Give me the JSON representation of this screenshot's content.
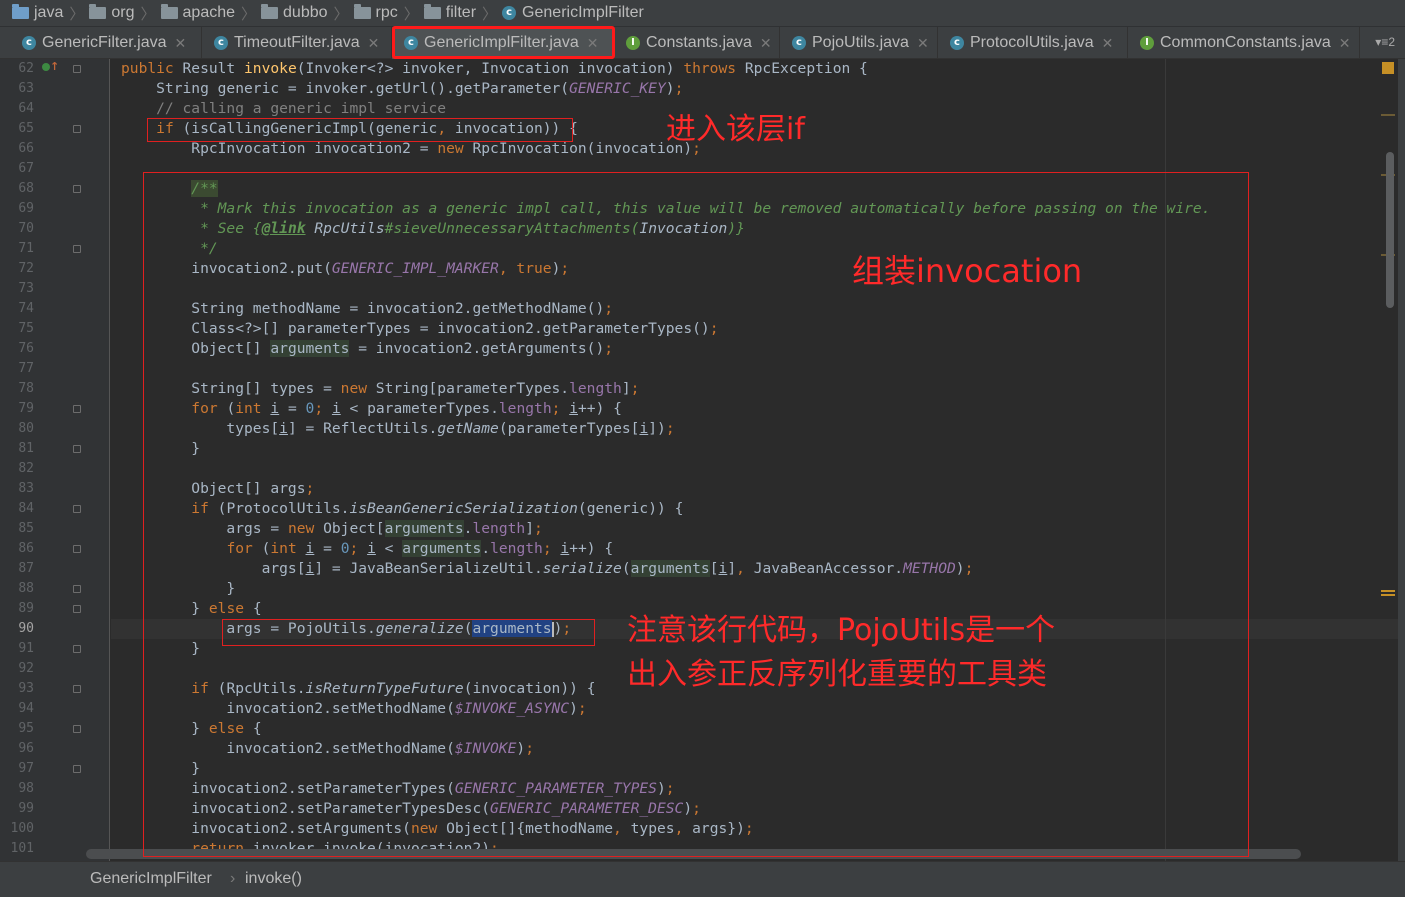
{
  "breadcrumb": [
    "java",
    "org",
    "apache",
    "dubbo",
    "rpc",
    "filter",
    "GenericImplFilter"
  ],
  "tabs": [
    {
      "label": "GenericFilter.java",
      "type": "class",
      "active": false
    },
    {
      "label": "TimeoutFilter.java",
      "type": "class",
      "active": false
    },
    {
      "label": "GenericImplFilter.java",
      "type": "class",
      "active": true
    },
    {
      "label": "Constants.java",
      "type": "interface",
      "active": false
    },
    {
      "label": "PojoUtils.java",
      "type": "class",
      "active": false
    },
    {
      "label": "ProtocolUtils.java",
      "type": "class",
      "active": false
    },
    {
      "label": "CommonConstants.java",
      "type": "interface",
      "active": false
    }
  ],
  "tab_overflow": "▾≡2",
  "line_numbers": [
    "62",
    "63",
    "64",
    "65",
    "66",
    "67",
    "68",
    "69",
    "70",
    "71",
    "72",
    "73",
    "74",
    "75",
    "76",
    "77",
    "78",
    "79",
    "80",
    "81",
    "82",
    "83",
    "84",
    "85",
    "86",
    "87",
    "88",
    "89",
    "90",
    "91",
    "92",
    "93",
    "94",
    "95",
    "96",
    "97",
    "98",
    "99",
    "100",
    "101"
  ],
  "current_line": "90",
  "status_bar": {
    "class_name": "GenericImplFilter",
    "method_name": "invoke()"
  },
  "annotations": {
    "if_note": "进入该层if",
    "assemble_note": "组装invocation",
    "pojo_note_line1": "注意该行代码，PojoUtils是一个",
    "pojo_note_line2": "出入参正反序列化重要的工具类"
  },
  "colors": {
    "annotation_red": "#ff2a2a",
    "editor_bg": "#2b2b2b",
    "keyword": "#cc7832",
    "constant": "#9876aa"
  }
}
